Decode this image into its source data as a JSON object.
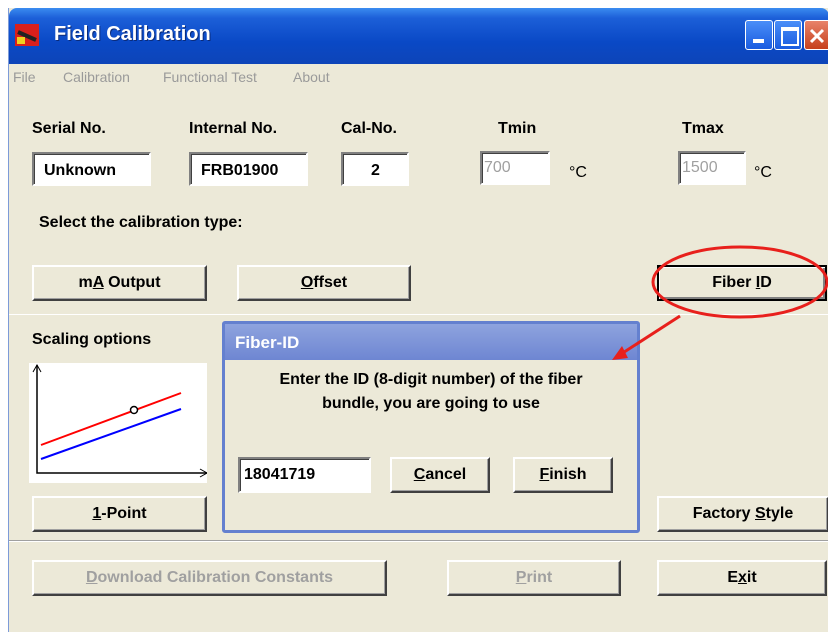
{
  "window": {
    "title": "Field Calibration"
  },
  "menu": [
    "File",
    "Calibration",
    "Functional Test",
    "About"
  ],
  "fields": {
    "serial": {
      "label": "Serial No.",
      "value": "Unknown"
    },
    "internal": {
      "label": "Internal No.",
      "value": "FRB01900"
    },
    "calno": {
      "label": "Cal-No.",
      "value": "2"
    },
    "tmin": {
      "label": "Tmin",
      "value": "700",
      "unit": "°C"
    },
    "tmax": {
      "label": "Tmax",
      "value": "1500",
      "unit": "°C"
    }
  },
  "select_prompt": "Select the calibration type:",
  "calib_buttons": {
    "ma_pre": "m",
    "ma_mn": "A",
    "ma_post": " Output",
    "offset_mn": "O",
    "offset_post": "ffset",
    "fiber_pre": "Fiber ",
    "fiber_mn": "I",
    "fiber_post": "D"
  },
  "scaling": {
    "label": "Scaling options",
    "point_mn": "1",
    "point_post": "-Point",
    "factory_pre": "Factory ",
    "factory_mn": "S",
    "factory_post": "tyle"
  },
  "dialog": {
    "title": "Fiber-ID",
    "line1": "Enter the ID (8-digit number) of the fiber",
    "line2": "bundle, you are going to use",
    "input_value": "18041719",
    "cancel_mn": "C",
    "cancel_post": "ancel",
    "finish_mn": "F",
    "finish_post": "inish"
  },
  "bottom": {
    "download_mn": "D",
    "download_post": "ownload Calibration Constants",
    "print_mn": "P",
    "print_post": "rint",
    "exit_pre": "E",
    "exit_mn": "x",
    "exit_post": "it"
  },
  "colors": {
    "titlebar": "#0a49c6",
    "dialog_title": "#7b91d8",
    "annotation": "#e8201c",
    "line_red": "#ff0000",
    "line_blue": "#0000ff"
  }
}
